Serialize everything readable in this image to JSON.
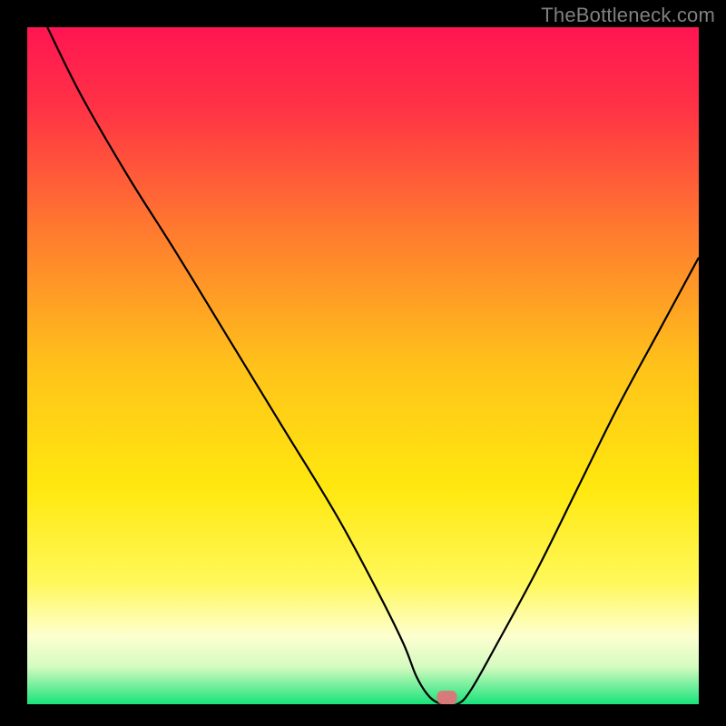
{
  "watermark": "TheBottleneck.com",
  "chart_data": {
    "type": "line",
    "title": "",
    "xlabel": "",
    "ylabel": "",
    "xlim": [
      0,
      100
    ],
    "ylim": [
      0,
      100
    ],
    "grid": false,
    "legend": false,
    "background_gradient": {
      "stops": [
        {
          "pos": 0.0,
          "color": "#ff1552"
        },
        {
          "pos": 0.12,
          "color": "#ff3345"
        },
        {
          "pos": 0.3,
          "color": "#ff7a2f"
        },
        {
          "pos": 0.5,
          "color": "#ffc21a"
        },
        {
          "pos": 0.68,
          "color": "#ffe80f"
        },
        {
          "pos": 0.82,
          "color": "#fff85a"
        },
        {
          "pos": 0.9,
          "color": "#fdffd0"
        },
        {
          "pos": 0.945,
          "color": "#d4fbc0"
        },
        {
          "pos": 0.97,
          "color": "#7ef0a0"
        },
        {
          "pos": 1.0,
          "color": "#18e37a"
        }
      ]
    },
    "series": [
      {
        "name": "bottleneck-curve",
        "stroke": "#000000",
        "x": [
          3,
          8,
          15,
          22,
          30,
          38,
          46,
          52,
          56,
          58,
          60,
          62,
          64,
          66,
          70,
          76,
          82,
          88,
          94,
          100
        ],
        "y": [
          100,
          90,
          78,
          67,
          54,
          41,
          28,
          17,
          9,
          4,
          1,
          0,
          0,
          2,
          9,
          20,
          32,
          44,
          55,
          66
        ]
      }
    ],
    "marker": {
      "name": "optimal-point",
      "x": 62.5,
      "y": 0,
      "color": "#d97a7a",
      "width_units": 3,
      "height_units": 2
    }
  }
}
